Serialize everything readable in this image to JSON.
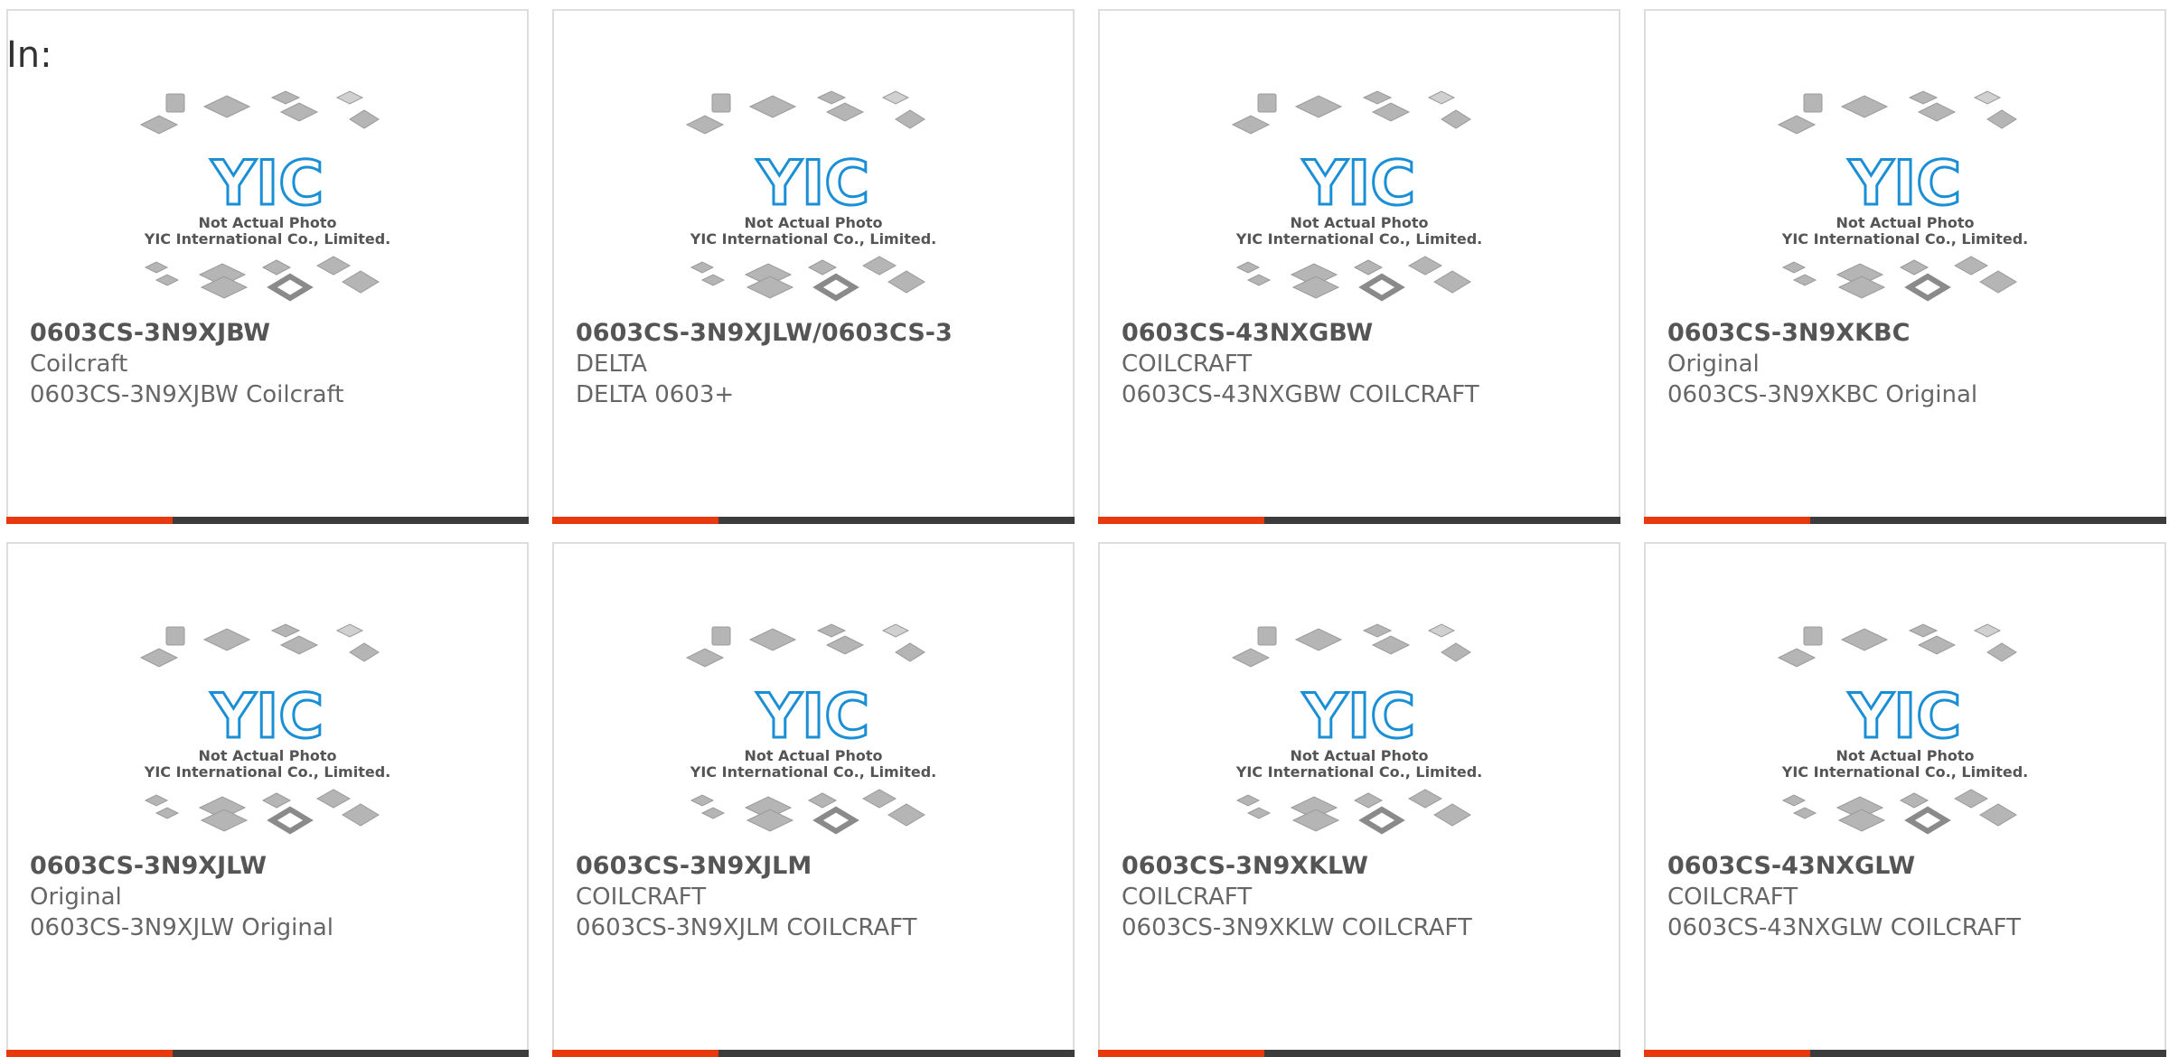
{
  "filter": {
    "label": "In:"
  },
  "colors": {
    "accent": "#e8380d",
    "dark_bar": "#3c3c3c",
    "border": "#dddddd",
    "logo_blue": "#1a8fd6"
  },
  "placeholder": {
    "logo_text": "YIC",
    "caption_line1": "Not Actual Photo",
    "caption_line2": "YIC International Co., Limited."
  },
  "products": [
    {
      "part_number": "0603CS-3N9XJBW",
      "brand": "Coilcraft",
      "description": "0603CS-3N9XJBW Coilcraft"
    },
    {
      "part_number": "0603CS-3N9XJLW/0603CS-3",
      "brand": "DELTA",
      "description": "DELTA 0603+"
    },
    {
      "part_number": "0603CS-43NXGBW",
      "brand": "COILCRAFT",
      "description": "0603CS-43NXGBW COILCRAFT"
    },
    {
      "part_number": "0603CS-3N9XKBC",
      "brand": "Original",
      "description": "0603CS-3N9XKBC Original"
    },
    {
      "part_number": "0603CS-3N9XJLW",
      "brand": "Original",
      "description": "0603CS-3N9XJLW Original"
    },
    {
      "part_number": "0603CS-3N9XJLM",
      "brand": "COILCRAFT",
      "description": "0603CS-3N9XJLM COILCRAFT"
    },
    {
      "part_number": "0603CS-3N9XKLW",
      "brand": "COILCRAFT",
      "description": "0603CS-3N9XKLW COILCRAFT"
    },
    {
      "part_number": "0603CS-43NXGLW",
      "brand": "COILCRAFT",
      "description": "0603CS-43NXGLW COILCRAFT"
    }
  ]
}
